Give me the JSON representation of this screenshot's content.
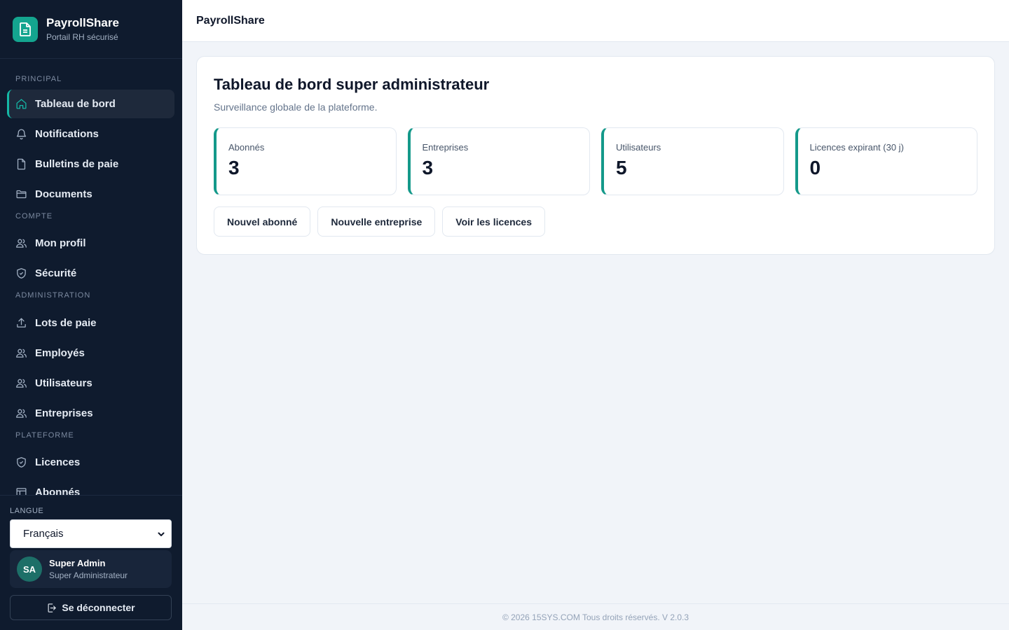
{
  "brand": {
    "name": "PayrollShare",
    "subtitle": "Portail RH sécurisé",
    "accent": "#14a58f"
  },
  "nav": {
    "sections": [
      {
        "title": "PRINCIPAL",
        "items": [
          {
            "label": "Tableau de bord",
            "icon": "home-icon",
            "active": true
          },
          {
            "label": "Notifications",
            "icon": "bell-icon"
          },
          {
            "label": "Bulletins de paie",
            "icon": "file-icon"
          },
          {
            "label": "Documents",
            "icon": "folder-icon"
          }
        ]
      },
      {
        "title": "COMPTE",
        "items": [
          {
            "label": "Mon profil",
            "icon": "users-icon"
          },
          {
            "label": "Sécurité",
            "icon": "shield-icon"
          }
        ]
      },
      {
        "title": "ADMINISTRATION",
        "items": [
          {
            "label": "Lots de paie",
            "icon": "upload-icon"
          },
          {
            "label": "Employés",
            "icon": "users-icon"
          },
          {
            "label": "Utilisateurs",
            "icon": "users-icon"
          },
          {
            "label": "Entreprises",
            "icon": "users-icon"
          }
        ]
      },
      {
        "title": "PLATEFORME",
        "items": [
          {
            "label": "Licences",
            "icon": "shield-icon"
          },
          {
            "label": "Abonnés",
            "icon": "list-icon"
          }
        ]
      }
    ]
  },
  "language": {
    "label": "LANGUE",
    "selected": "Français"
  },
  "user": {
    "initials": "SA",
    "name": "Super Admin",
    "role": "Super Administrateur"
  },
  "logout_label": "Se déconnecter",
  "topbar": {
    "title": "PayrollShare"
  },
  "dashboard": {
    "title": "Tableau de bord super administrateur",
    "subtitle": "Surveillance globale de la plateforme.",
    "stats": [
      {
        "label": "Abonnés",
        "value": "3"
      },
      {
        "label": "Entreprises",
        "value": "3"
      },
      {
        "label": "Utilisateurs",
        "value": "5"
      },
      {
        "label": "Licences expirant (30 j)",
        "value": "0"
      }
    ],
    "actions": [
      {
        "label": "Nouvel abonné"
      },
      {
        "label": "Nouvelle entreprise"
      },
      {
        "label": "Voir les licences"
      }
    ]
  },
  "footer": {
    "text": "© 2026 15SYS.COM Tous droits réservés. V 2.0.3"
  }
}
